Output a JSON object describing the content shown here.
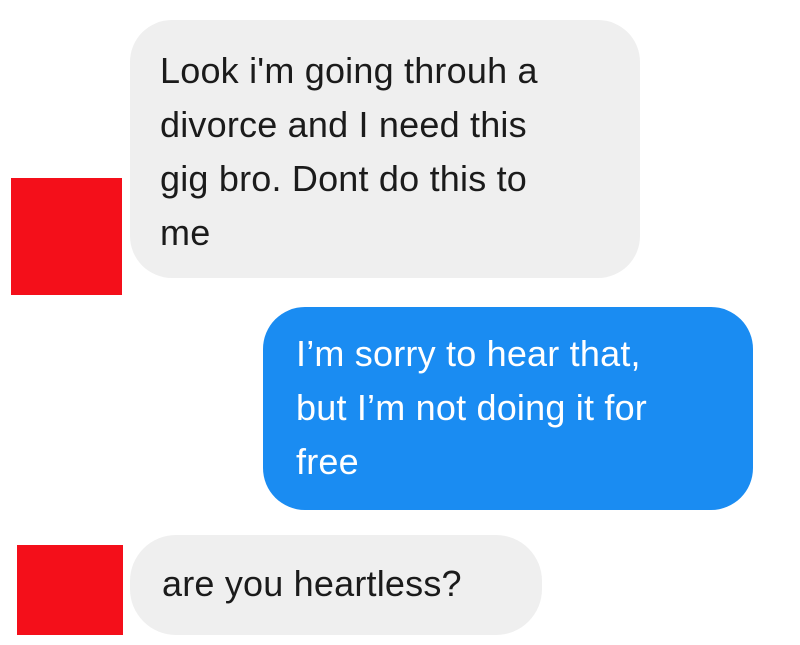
{
  "conversation": {
    "messages": [
      {
        "direction": "incoming",
        "text": "Look i'm going throuh a\ndivorce and I need this\ngig bro. Dont do this to\nme"
      },
      {
        "direction": "outgoing",
        "text": "I’m sorry to hear that,\nbut I’m not doing it for\nfree"
      },
      {
        "direction": "incoming",
        "text": "are you heartless?"
      }
    ]
  },
  "colors": {
    "incoming_bubble": "#efefef",
    "incoming_text": "#1b1b1b",
    "outgoing_bubble": "#1a8cf2",
    "outgoing_text": "#ffffff",
    "avatar_redaction": "#f40f1a"
  }
}
